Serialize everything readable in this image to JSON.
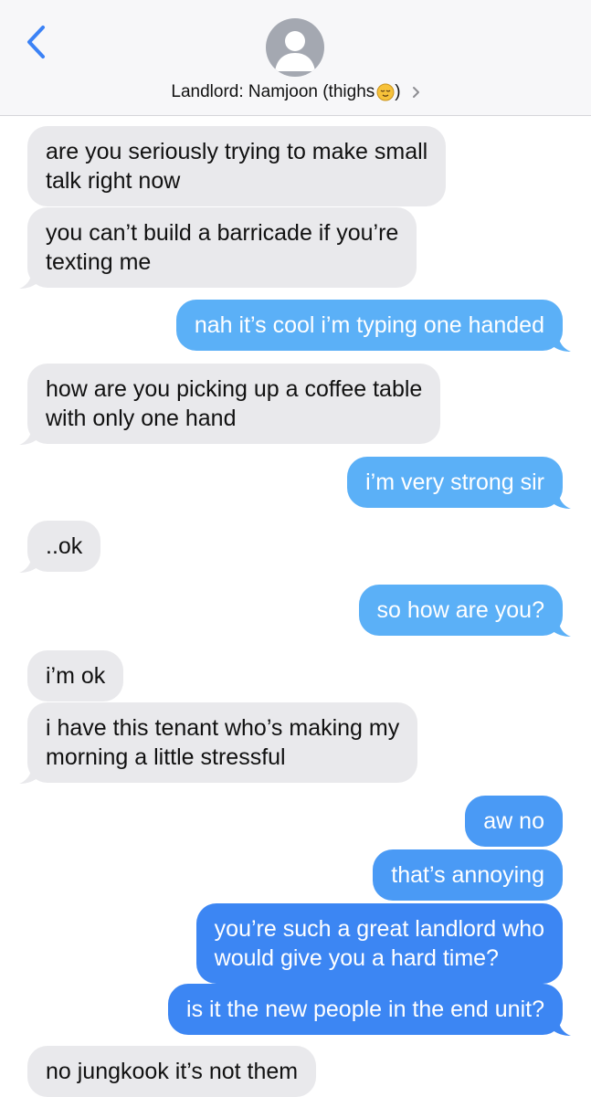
{
  "header": {
    "back_icon": "chevron-left-icon",
    "contact_name": "Landlord: Namjoon (thighs",
    "contact_suffix": ")",
    "emoji": "relieved-face-emoji",
    "chevron": "chevron-right-icon"
  },
  "colors": {
    "incoming": "#e9e9ec",
    "outgoing_light": "#5bb0f7",
    "outgoing_mid": "#4a9af5",
    "outgoing_dark": "#3c86f3",
    "ios_blue": "#3b82f6"
  },
  "messages": [
    {
      "direction": "incoming",
      "lines": [
        "are you seriously trying to make small",
        "talk right now"
      ]
    },
    {
      "direction": "incoming",
      "lines": [
        "you can’t build a barricade if you’re",
        "texting me"
      ]
    },
    {
      "direction": "outgoing",
      "lines": [
        "nah it’s cool i’m typing one handed"
      ]
    },
    {
      "direction": "incoming",
      "lines": [
        "how are you picking up a coffee table",
        "with only one hand"
      ]
    },
    {
      "direction": "outgoing",
      "lines": [
        "i’m very strong sir"
      ]
    },
    {
      "direction": "incoming",
      "lines": [
        "..ok"
      ]
    },
    {
      "direction": "outgoing",
      "lines": [
        "so how are you?"
      ]
    },
    {
      "direction": "incoming",
      "lines": [
        "i’m ok"
      ]
    },
    {
      "direction": "incoming",
      "lines": [
        "i have this tenant who’s making my",
        "morning a little stressful"
      ]
    },
    {
      "direction": "outgoing",
      "lines": [
        "aw no"
      ]
    },
    {
      "direction": "outgoing",
      "lines": [
        "that’s annoying"
      ]
    },
    {
      "direction": "outgoing",
      "lines": [
        "you’re such a great landlord who",
        "would give you a hard time?"
      ]
    },
    {
      "direction": "outgoing",
      "lines": [
        "is it the new people in the end unit?"
      ]
    },
    {
      "direction": "incoming",
      "lines": [
        "no jungkook it’s not them"
      ]
    }
  ]
}
